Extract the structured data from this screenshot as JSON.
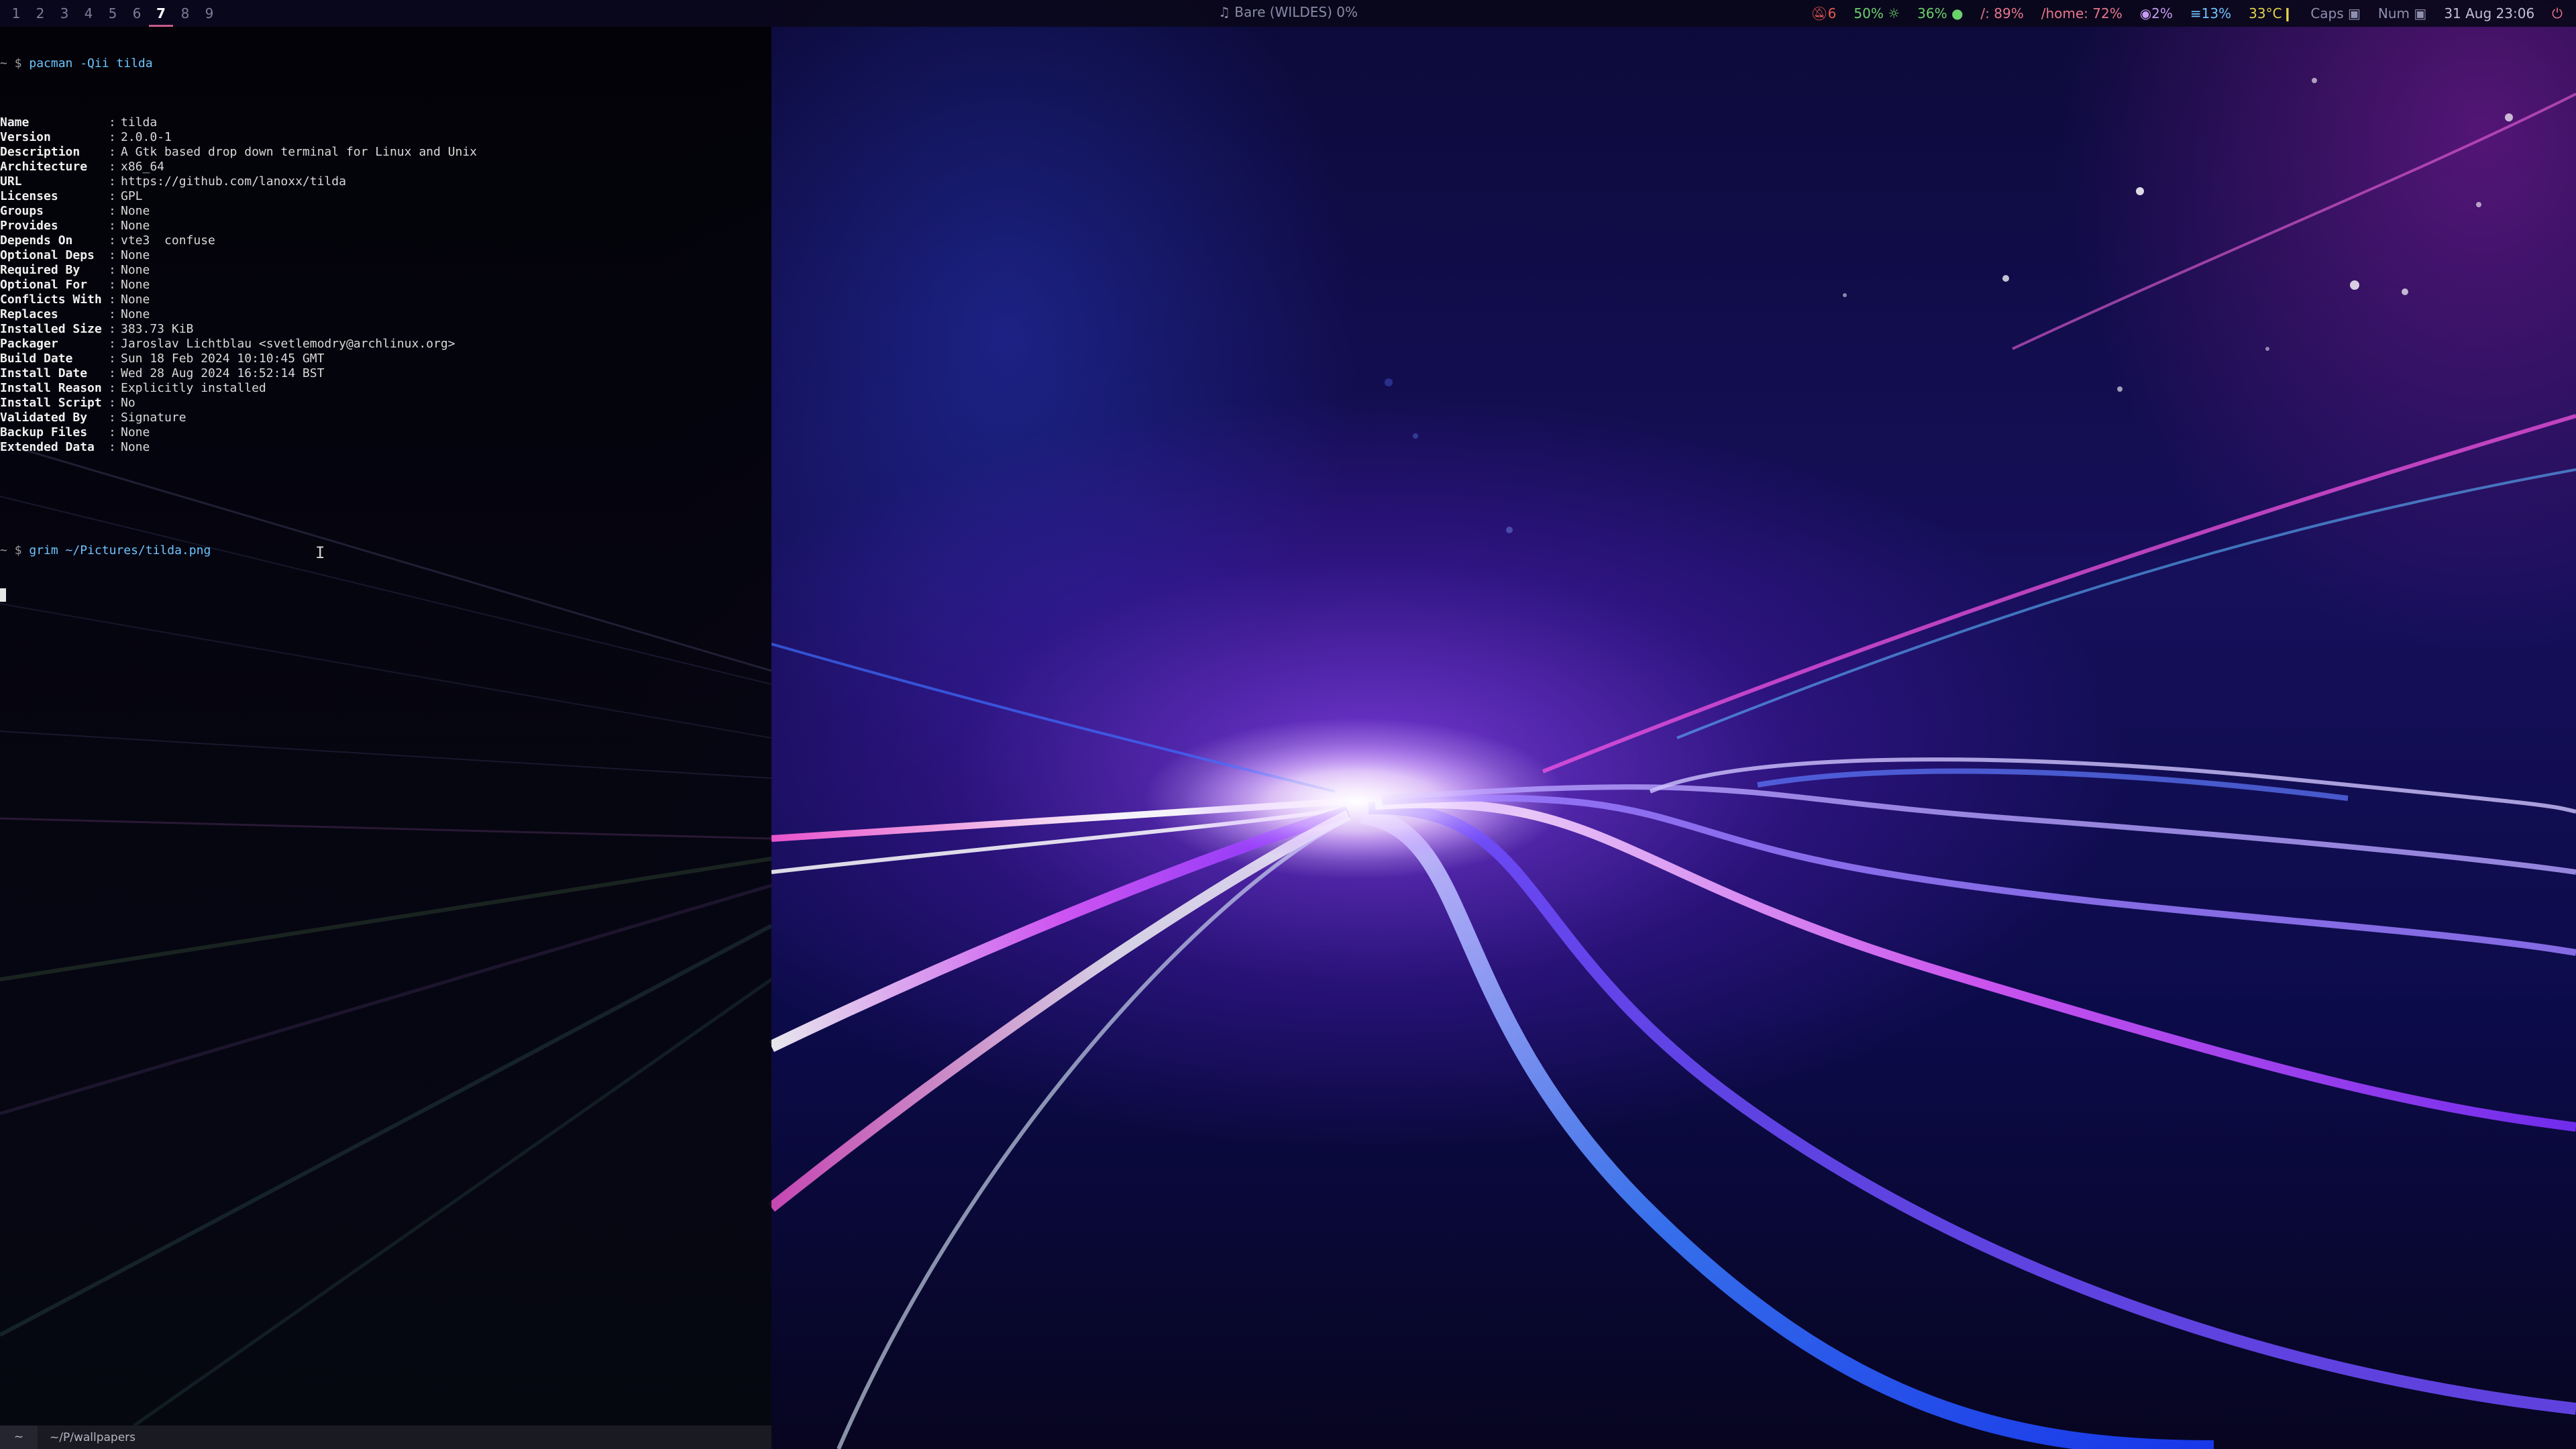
{
  "topbar": {
    "workspaces": [
      "1",
      "2",
      "3",
      "4",
      "5",
      "6",
      "7",
      "8",
      "9"
    ],
    "active_workspace": "7",
    "media": "♫ Bare (WILDES) 0%",
    "status": {
      "notifications": "6",
      "brightness": "50%",
      "volume": "36%",
      "root_disk": "/: 89%",
      "home_disk": "/home: 72%",
      "cpu": "2%",
      "memory": "13%",
      "temperature": "33°C",
      "caps": "Caps",
      "num": "Num",
      "datetime": "31 Aug 23:06"
    },
    "colors": {
      "notifications": "#e85a4f",
      "brightness": "#6bd36b",
      "volume": "#6bd36b",
      "root_disk": "#e8768a",
      "home_disk": "#e8768a",
      "cpu": "#c79cf2",
      "memory": "#6fc3ff",
      "temperature": "#e3d64a",
      "lock": "#8f8fae",
      "datetime": "#c0c0d8",
      "active_ws_underline": "#c75b8c"
    }
  },
  "terminal": {
    "command1": {
      "prompt": "~ $",
      "text": "pacman -Qii tilda"
    },
    "package_info": [
      {
        "key": "Name",
        "value": "tilda"
      },
      {
        "key": "Version",
        "value": "2.0.0-1"
      },
      {
        "key": "Description",
        "value": "A Gtk based drop down terminal for Linux and Unix"
      },
      {
        "key": "Architecture",
        "value": "x86_64"
      },
      {
        "key": "URL",
        "value": "https://github.com/lanoxx/tilda"
      },
      {
        "key": "Licenses",
        "value": "GPL"
      },
      {
        "key": "Groups",
        "value": "None"
      },
      {
        "key": "Provides",
        "value": "None"
      },
      {
        "key": "Depends On",
        "value": "vte3  confuse"
      },
      {
        "key": "Optional Deps",
        "value": "None"
      },
      {
        "key": "Required By",
        "value": "None"
      },
      {
        "key": "Optional For",
        "value": "None"
      },
      {
        "key": "Conflicts With",
        "value": "None"
      },
      {
        "key": "Replaces",
        "value": "None"
      },
      {
        "key": "Installed Size",
        "value": "383.73 KiB"
      },
      {
        "key": "Packager",
        "value": "Jaroslav Lichtblau <svetlemodry@archlinux.org>"
      },
      {
        "key": "Build Date",
        "value": "Sun 18 Feb 2024 10:10:45 GMT"
      },
      {
        "key": "Install Date",
        "value": "Wed 28 Aug 2024 16:52:14 BST"
      },
      {
        "key": "Install Reason",
        "value": "Explicitly installed"
      },
      {
        "key": "Install Script",
        "value": "No"
      },
      {
        "key": "Validated By",
        "value": "Signature"
      },
      {
        "key": "Backup Files",
        "value": "None"
      },
      {
        "key": "Extended Data",
        "value": "None"
      }
    ],
    "separator": ":",
    "command2": {
      "prompt": "~ $",
      "text": "grim ~/Pictures/tilda.png"
    },
    "statusline": {
      "mode": "~",
      "path": "~/P/wallpapers"
    }
  }
}
